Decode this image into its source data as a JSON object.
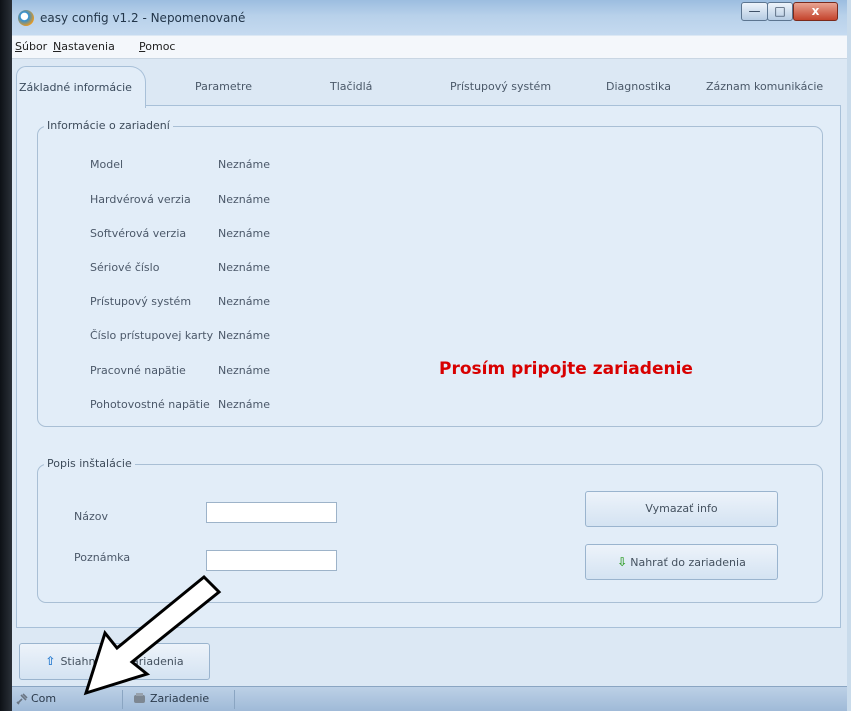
{
  "window": {
    "title": "easy config v1.2 - Nepomenované",
    "minimize_label": "—",
    "maximize_label": "□",
    "close_label": "x"
  },
  "menu": {
    "items": [
      "Súbor",
      "Nastavenia",
      "Pomoc"
    ]
  },
  "tabs": [
    {
      "label": "Základné informácie",
      "active": true
    },
    {
      "label": "Parametre",
      "active": false
    },
    {
      "label": "Tlačidlá",
      "active": false
    },
    {
      "label": "Prístupový systém",
      "active": false
    },
    {
      "label": "Diagnostika",
      "active": false
    },
    {
      "label": "Záznam komunikácie",
      "active": false
    }
  ],
  "device_info": {
    "legend": "Informácie o zariadení",
    "rows": [
      {
        "label": "Model",
        "value": "Neznáme"
      },
      {
        "label": "Hardvérová verzia",
        "value": "Neznáme"
      },
      {
        "label": "Softvérová verzia",
        "value": "Neznáme"
      },
      {
        "label": "Sériové číslo",
        "value": "Neznáme"
      },
      {
        "label": "Prístupový systém",
        "value": "Neznáme"
      },
      {
        "label": "Číslo prístupovej karty",
        "value": "Neznáme"
      },
      {
        "label": "Pracovné napätie",
        "value": "Neznáme"
      },
      {
        "label": "Pohotovostné napätie",
        "value": "Neznáme"
      }
    ],
    "warning": "Prosím pripojte zariadenie",
    "warning_color": "#d80000"
  },
  "install": {
    "legend": "Popis inštalácie",
    "name_label": "Názov",
    "name_value": "",
    "note_label": "Poznámka",
    "note_value": "",
    "clear_button": "Vymazať info",
    "upload_button": "Nahrať do zariadenia",
    "upload_icon": "arrow-down-icon"
  },
  "bottom": {
    "download_button": "Stiahnuť zo zariadenia",
    "download_icon": "arrow-up-icon"
  },
  "statusbar": {
    "com_label": "Com",
    "device_label": "Zariadenie",
    "com_icon": "plug-icon",
    "device_icon": "device-icon"
  }
}
